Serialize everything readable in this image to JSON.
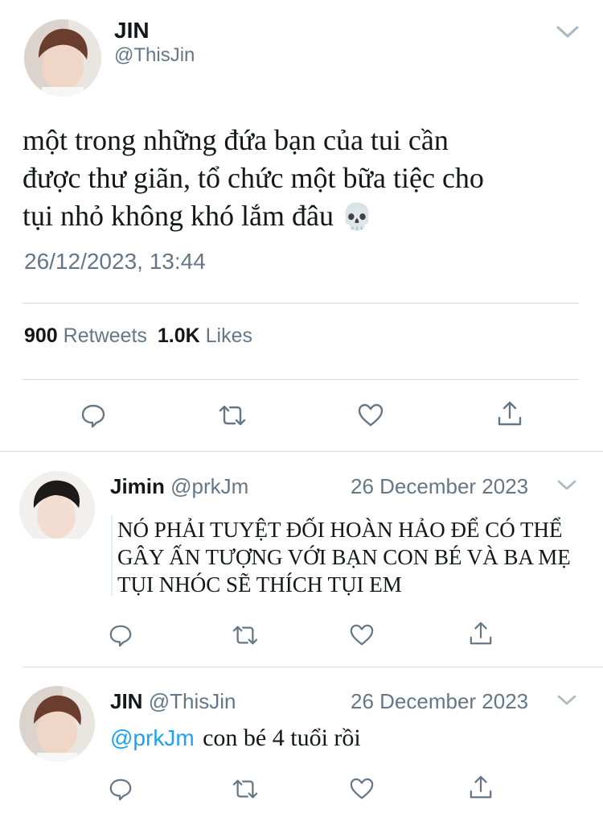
{
  "main_tweet": {
    "author": {
      "name": "JIN",
      "handle": "@ThisJin",
      "avatar_icon": "person-avatar"
    },
    "text_lines": [
      "một trong những đứa bạn của tui cần",
      "được thư giãn, tổ chức một bữa tiệc cho",
      "tụi nhỏ không khó lắm đâu"
    ],
    "emoji": "💀",
    "timestamp": "26/12/2023, 13:44",
    "stats": {
      "retweets_count": "900",
      "retweets_label": "Retweets",
      "likes_count": "1.0K",
      "likes_label": "Likes"
    },
    "actions": [
      "reply-icon",
      "retweet-icon",
      "like-icon",
      "share-icon"
    ]
  },
  "replies": [
    {
      "author": {
        "name": "Jimin",
        "handle": "@prkJm",
        "avatar_icon": "person-avatar"
      },
      "date": "26 December 2023",
      "text_lines": [
        "NÓ PHẢI TUYỆT ĐỐI HOÀN HẢO ĐỂ CÓ THỂ",
        "GÂY ẤN TƯỢNG VỚI BẠN CON BÉ VÀ BA MẸ",
        "TỤI NHÓC SẼ THÍCH TỤI EM"
      ]
    },
    {
      "author": {
        "name": "JIN",
        "handle": "@ThisJin",
        "avatar_icon": "person-avatar"
      },
      "date": "26 December 2023",
      "mention": "@prkJm",
      "text": "con bé 4 tuổi rồi"
    }
  ],
  "colors": {
    "link": "#1da1f2",
    "muted": "#657786",
    "divider": "#d6dadd",
    "icon": "#657786"
  }
}
